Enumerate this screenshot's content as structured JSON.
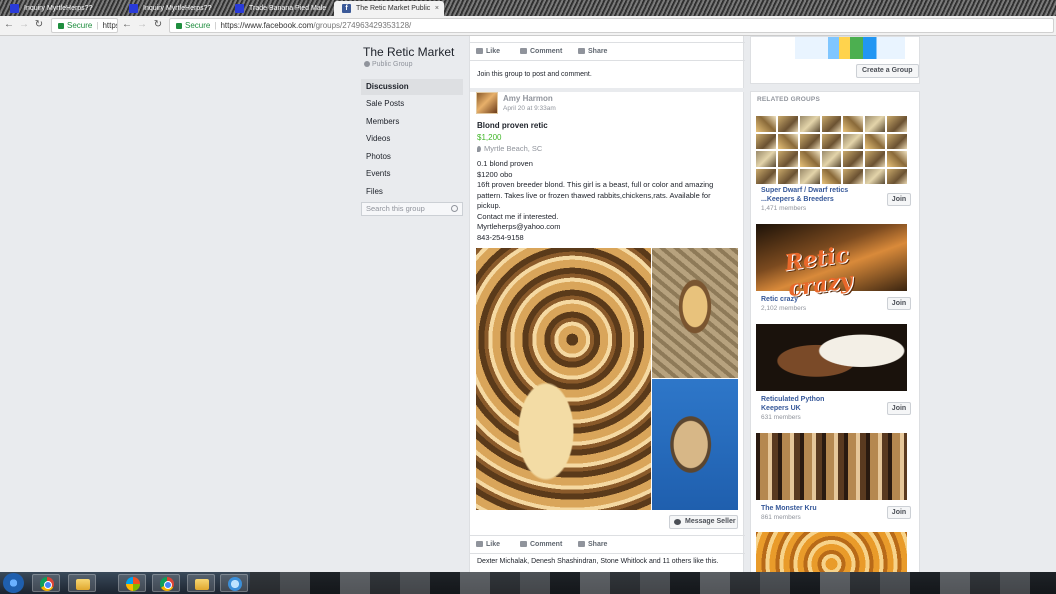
{
  "browser": {
    "tabs": [
      {
        "title": "Inquiry MyrtleHerps??"
      },
      {
        "title": "Inquiry MyrtleHerps??"
      },
      {
        "title": "Trade Banana Pied Male"
      },
      {
        "title": "The Retic Market Public",
        "close": "×",
        "favicon": "f"
      }
    ],
    "left_omnibox": {
      "secure": "Secure",
      "url": "https:"
    },
    "right_omnibox": {
      "secure": "Secure",
      "host": "https://www.facebook.com",
      "path": "/groups/274963429353128/"
    }
  },
  "group": {
    "name": "The Retic Market",
    "type": "Public Group",
    "nav": [
      "Discussion",
      "Sale Posts",
      "Members",
      "Videos",
      "Photos",
      "Events",
      "Files"
    ],
    "search_placeholder": "Search this group"
  },
  "feed": {
    "top_actions": {
      "like": "Like",
      "comment": "Comment",
      "share": "Share"
    },
    "join_note": "Join this group to post and comment.",
    "post": {
      "author": "Amy Harmon",
      "time": "April 20 at 9:33am",
      "title": "Blond proven retic",
      "price": "$1,200",
      "location": "Myrtle Beach, SC",
      "body": [
        "0.1 blond proven",
        "$1200 obo",
        "16ft proven breeder blond. This girl is a beast, full or color and amazing pattern. Takes live or frozen thawed rabbits,chickens,rats. Available for pickup.",
        "Contact me if interested.",
        "Myrtleherps@yahoo.com",
        "843-254-9158"
      ],
      "message_seller": "Message Seller",
      "actions": {
        "like": "Like",
        "comment": "Comment",
        "share": "Share"
      },
      "likers": "Dexter Michalak, Denesh Shashindran, Stone Whitlock and 11 others like this."
    }
  },
  "sidebar": {
    "create_group": "Create a Group",
    "related_heading": "RELATED GROUPS",
    "related_groups": [
      {
        "name": "Super Dwarf / Dwarf retics ...Keepers & Breeders",
        "members": "1,471 members",
        "join": "Join"
      },
      {
        "name": "Retic crazy",
        "members": "2,102 members",
        "join": "Join",
        "image_text": "Retic crazy"
      },
      {
        "name": "Reticulated Python Keepers UK",
        "members": "631 members",
        "join": "Join"
      },
      {
        "name": "The Monster Kru",
        "members": "861 members",
        "join": "Join"
      }
    ]
  },
  "icons": [
    "back-arrow-icon",
    "forward-arrow-icon",
    "reload-icon",
    "lock-icon",
    "globe-icon",
    "search-icon",
    "like-icon",
    "comment-icon",
    "share-icon",
    "location-pin-icon",
    "messenger-icon",
    "chrome-icon",
    "folder-icon",
    "windows-start-icon"
  ]
}
